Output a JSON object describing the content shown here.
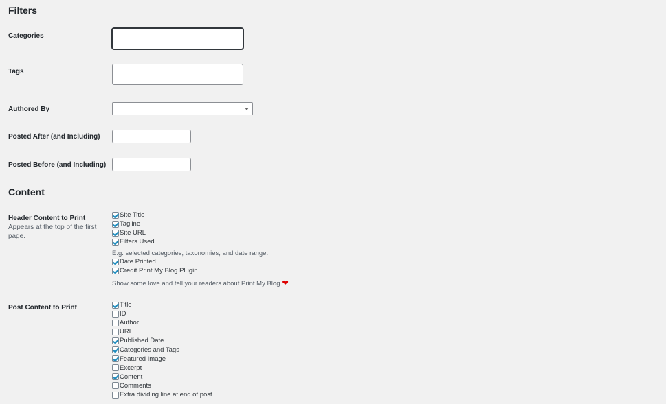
{
  "filters": {
    "heading": "Filters",
    "categories_label": "Categories",
    "tags_label": "Tags",
    "authored_by_label": "Authored By",
    "authored_by_value": "",
    "posted_after_label": "Posted After (and Including)",
    "posted_before_label": "Posted Before (and Including)"
  },
  "content": {
    "heading": "Content",
    "header_label": "Header Content to Print",
    "header_desc": "Appears at the top of the first page.",
    "header_items": [
      {
        "label": "Site Title",
        "checked": true
      },
      {
        "label": "Tagline",
        "checked": true
      },
      {
        "label": "Site URL",
        "checked": true
      },
      {
        "label": "Filters Used",
        "checked": true
      },
      {
        "label": "Date Printed",
        "checked": true
      },
      {
        "label": "Credit Print My Blog Plugin",
        "checked": true
      }
    ],
    "filters_note": "E.g. selected categories, taxonomies, and date range.",
    "credit_note": "Show some love and tell your readers about Print My Blog",
    "heart_icon": "❤",
    "post_label": "Post Content to Print",
    "post_items": [
      {
        "label": "Title",
        "checked": true
      },
      {
        "label": "ID",
        "checked": false
      },
      {
        "label": "Author",
        "checked": false
      },
      {
        "label": "URL",
        "checked": false
      },
      {
        "label": "Published Date",
        "checked": true
      },
      {
        "label": "Categories and Tags",
        "checked": true
      },
      {
        "label": "Featured Image",
        "checked": true
      },
      {
        "label": "Excerpt",
        "checked": false
      },
      {
        "label": "Content",
        "checked": true
      },
      {
        "label": "Comments",
        "checked": false
      },
      {
        "label": "Extra dividing line at end of post",
        "checked": false
      }
    ]
  }
}
